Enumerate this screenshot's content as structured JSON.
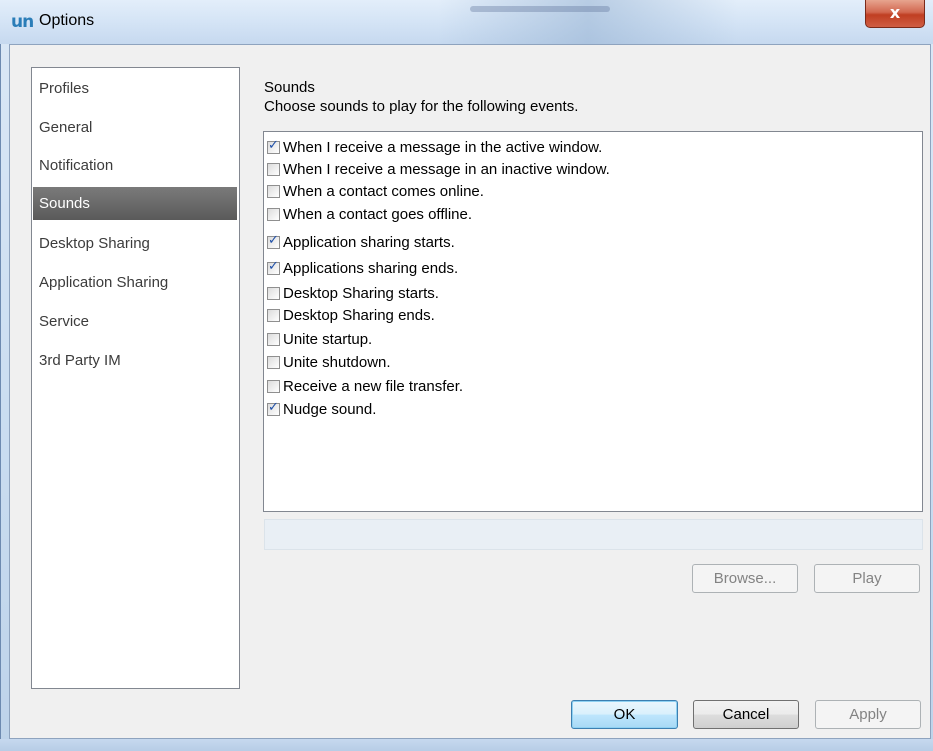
{
  "window": {
    "logo": "un",
    "title": "Options",
    "close_glyph": "x"
  },
  "sidebar": {
    "items": [
      {
        "label": "Profiles"
      },
      {
        "label": "General"
      },
      {
        "label": "Notification"
      },
      {
        "label": "Sounds",
        "selected": true
      },
      {
        "label": "Desktop Sharing"
      },
      {
        "label": "Application  Sharing"
      },
      {
        "label": "Service"
      },
      {
        "label": "3rd Party IM"
      }
    ]
  },
  "sounds": {
    "heading": "Sounds",
    "description": "Choose sounds to play for the following events.",
    "events": [
      {
        "label": "When I receive a message in the active window.",
        "checked": true
      },
      {
        "label": "When I receive a message in an inactive window.",
        "checked": false
      },
      {
        "label": "When a contact comes online.",
        "checked": false
      },
      {
        "label": "When a contact goes offline.",
        "checked": false
      },
      {
        "label": "Application sharing starts.",
        "checked": true
      },
      {
        "label": "Applications sharing ends.",
        "checked": true
      },
      {
        "label": "Desktop Sharing starts.",
        "checked": false
      },
      {
        "label": "Desktop Sharing ends.",
        "checked": false
      },
      {
        "label": "Unite startup.",
        "checked": false
      },
      {
        "label": "Unite shutdown.",
        "checked": false
      },
      {
        "label": "Receive a new file transfer.",
        "checked": false
      },
      {
        "label": "Nudge sound.",
        "checked": true
      }
    ],
    "sound_file_value": "",
    "browse_label": "Browse...",
    "play_label": "Play"
  },
  "footer": {
    "ok_label": "OK",
    "cancel_label": "Cancel",
    "apply_label": "Apply"
  },
  "colors": {
    "selected_item_bg": "#636363",
    "checkmark": "#1e4fa8",
    "close_button": "#c9503a",
    "logo": "#2a7db8"
  }
}
